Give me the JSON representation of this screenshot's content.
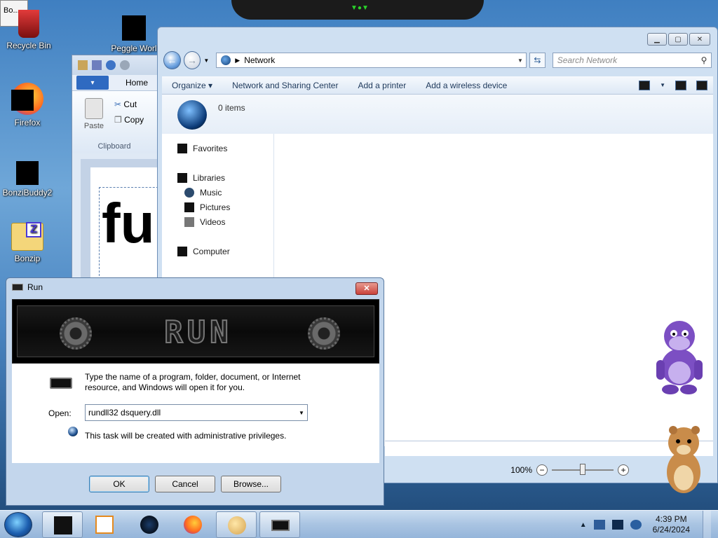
{
  "tooltip": "Bo...",
  "desktop": {
    "icons": [
      {
        "label": "Recycle Bin"
      },
      {
        "label": "Peggle Worl"
      },
      {
        "label": "Firefox"
      },
      {
        "label": "BonziBuddy2"
      },
      {
        "label": "Bonzip"
      }
    ]
  },
  "paint": {
    "file_tab": "▾",
    "home_tab": "Home",
    "paste": "Paste",
    "cut": "Cut",
    "copy": "Copy",
    "group": "Clipboard",
    "canvas_text": "fu"
  },
  "explorer": {
    "address": "Network",
    "search_placeholder": "Search Network",
    "commands": [
      "Organize ▾",
      "Network and Sharing Center",
      "Add a printer",
      "Add a wireless device"
    ],
    "item_count": "0 items",
    "nav": {
      "favorites": "Favorites",
      "libraries": "Libraries",
      "music": "Music",
      "pictures": "Pictures",
      "videos": "Videos",
      "computer": "Computer"
    },
    "zoom": "100%"
  },
  "run": {
    "title": "Run",
    "banner_word": "RUN",
    "description": "Type the name of a program, folder, document, or Internet resource, and Windows will open it for you.",
    "open_label": "Open:",
    "open_value": "rundll32 dsquery.dll",
    "admin_note": "This task will be created with administrative privileges.",
    "ok": "OK",
    "cancel": "Cancel",
    "browse": "Browse..."
  },
  "taskbar": {
    "time": "4:39 PM",
    "date": "6/24/2024"
  }
}
